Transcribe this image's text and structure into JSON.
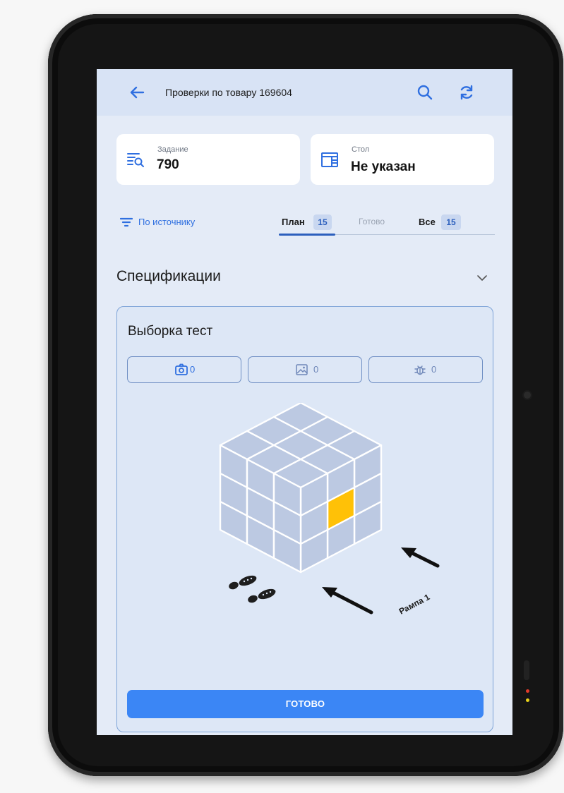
{
  "header": {
    "title": "Проверки по товару 169604",
    "icons": [
      "arrow-left-icon",
      "search-icon",
      "refresh-icon"
    ]
  },
  "task_card": {
    "label": "Задание",
    "value": "790",
    "icon": "task-list-search-icon"
  },
  "table_card": {
    "label": "Стол",
    "value": "Не указан",
    "icon": "table-icon"
  },
  "filter": {
    "label": "По источнику",
    "icon": "filter-icon"
  },
  "tabs": [
    {
      "label": "План",
      "count": "15",
      "active": true
    },
    {
      "label": "Готово",
      "count": "",
      "active": false
    },
    {
      "label": "Все",
      "count": "15",
      "active": false
    }
  ],
  "section": {
    "title": "Спецификации",
    "collapsed_icon": "chevron-down-icon"
  },
  "spec": {
    "title": "Выборка тест",
    "media": [
      {
        "icon": "camera-icon",
        "count": "0"
      },
      {
        "icon": "image-icon",
        "count": "0"
      },
      {
        "icon": "bug-icon",
        "count": "0"
      }
    ],
    "diagram_label": "Рампа 1",
    "highlight_color": "#ffc107"
  },
  "ready_button": {
    "label": "ГОТОВО"
  },
  "colors": {
    "accent": "#2f6fe0",
    "button": "#3b86f5",
    "cube": "#bcc9e2"
  }
}
